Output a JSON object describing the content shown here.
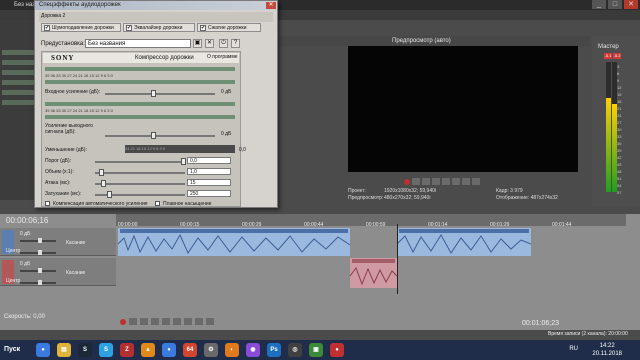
{
  "app": {
    "title": "Без назва...",
    "win_min": "_",
    "win_max": "□",
    "win_close": "✕"
  },
  "dialog": {
    "title": "Спецэффекты аудиодорожек",
    "close": "✕",
    "track_tag": "Дорожка 2",
    "tabs": [
      {
        "label": "Шумоподавление дорожки",
        "checked": "✔"
      },
      {
        "label": "Эквалайзер дорожки",
        "checked": "✔"
      },
      {
        "label": "Сжатие дорожки",
        "checked": "✔"
      }
    ],
    "preset_label": "Предустановка:",
    "preset_value": "Без названия",
    "plugin": {
      "brand": "SONY",
      "name": "Компрессор дорожки",
      "about": "О программе"
    },
    "scale_top": "39  36  33  30  27  24  21  18  15  12   9   6   3   0",
    "scale_mid": "39  36  33  30  27  24  21  18  15  12   9   6   3   0",
    "input_gain_label": "Входное усиление (дБ):",
    "input_gain_value": "0 дБ",
    "output_gain_label": "Усиление выходного сигнала (дБ):",
    "output_gain_value": "0 дБ",
    "reduction_label": "Уменьшение (дБ):",
    "reduction_scale": "24   21   18   15   12    9    6    3    0",
    "reduction_value": "0,0",
    "threshold_label": "Порог (дБ):",
    "threshold_value": "0,0",
    "ratio_label": "Объем (x:1):",
    "ratio_value": "1,0",
    "attack_label": "Атака (мс):",
    "attack_value": "15",
    "release_label": "Затухание (мс):",
    "release_value": "250",
    "auto_gain_label": "Компенсация автоматического усиления",
    "smooth_label": "Плавное насыщение"
  },
  "preview": {
    "mode": "Предпросмотр (авто)",
    "project_label": "Проект:",
    "project_value": "1920x1080x32; 59,940i",
    "preview_label": "Предпросмотр:",
    "preview_value": "480x270x32; 59,940i",
    "frame_label": "Кадр:",
    "frame_value": "3 979",
    "display_label": "Отображение:",
    "display_value": "487x274x32"
  },
  "master": {
    "label": "Мастер",
    "badges": [
      "-5.1",
      "-5.2"
    ],
    "levels": [
      0.72,
      0.68
    ],
    "scale": [
      "3",
      "6",
      "9",
      "12",
      "15",
      "18",
      "21",
      "24",
      "27",
      "30",
      "33",
      "36",
      "39",
      "42",
      "45",
      "48",
      "51",
      "54",
      "57"
    ]
  },
  "timeline": {
    "time_readout": "00:00:06;16",
    "ticks": [
      "00:00:00",
      "00:00:15",
      "00:00:29",
      "00:00:44",
      "00:00:59",
      "00:01:14",
      "00:01:29",
      "00:01:44"
    ],
    "tracks": [
      {
        "num": "1",
        "vol": "0 дБ",
        "pan": "Центр",
        "mode": "Касание"
      },
      {
        "num": "2",
        "vol": "0 дБ",
        "pan": "Центр",
        "mode": "Касание"
      }
    ],
    "rate_label": "Скорость: 0,00",
    "time_bottom": "00:01:06;23",
    "rec_time": "Время записи (2 канала): 20:00:00"
  },
  "taskbar": {
    "start": "Пуск",
    "icons": [
      "chrome",
      "explorer",
      "steam",
      "skype",
      "filezilla",
      "vlc",
      "chrome2",
      "vegas64",
      "tool",
      "blender",
      "davinci",
      "photoshop",
      "obs",
      "media",
      "record"
    ],
    "icon_glyphs": [
      "●",
      "▤",
      "S",
      "S",
      "Z",
      "▲",
      "●",
      "64",
      "⚙",
      "◐",
      "◉",
      "Ps",
      "◎",
      "▣",
      "●"
    ],
    "lang": "RU",
    "time": "14:22",
    "date": "20.11.2018"
  },
  "colors": {
    "accent_blue": "#5b7fb1",
    "accent_red": "#b25858",
    "clip_blue": "#9bb8de",
    "clip_pink": "#cf9aa2"
  }
}
